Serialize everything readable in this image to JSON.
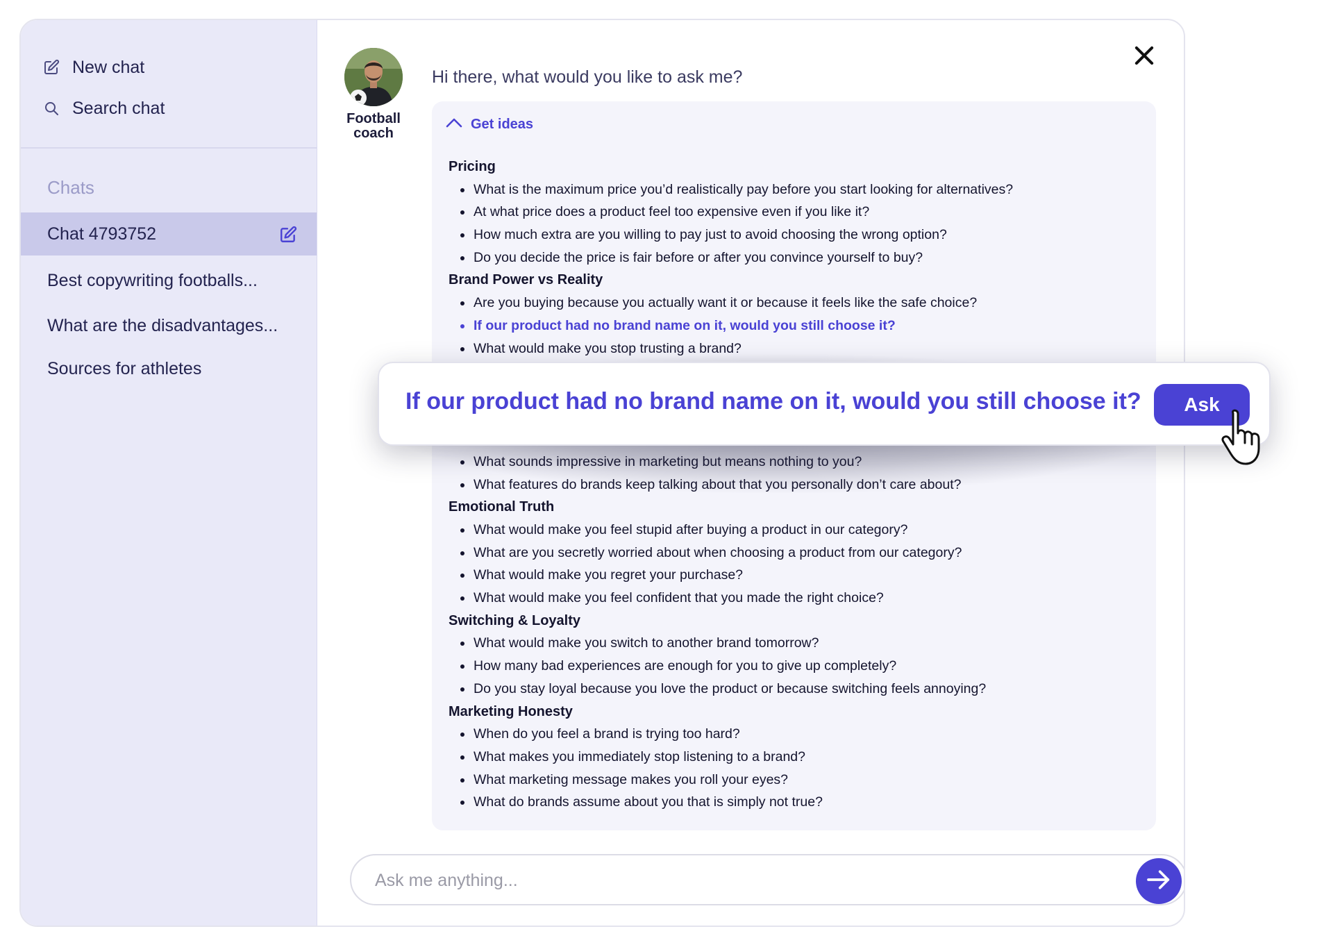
{
  "sidebar": {
    "new_chat": "New chat",
    "search_chat": "Search chat",
    "chats_heading": "Chats",
    "chats": [
      {
        "label": "Chat 4793752",
        "active": true
      },
      {
        "label": "Best copywriting footballs...",
        "active": false
      },
      {
        "label": "What are the disadvantages...",
        "active": false
      },
      {
        "label": "Sources for athletes",
        "active": false
      }
    ]
  },
  "main": {
    "agent_name": "Football coach",
    "greeting": "Hi there, what would you like to ask me?",
    "ideas_toggle": "Get ideas",
    "sections": [
      {
        "title": "Pricing",
        "questions": [
          "What is the maximum price you’d realistically pay before you start looking for alternatives?",
          "At what price does a product feel too expensive even if you like it?",
          "How much extra are you willing to pay just to avoid choosing the wrong option?",
          "Do you decide the price is fair before or after you convince yourself to buy?"
        ]
      },
      {
        "title": "Brand Power vs Reality",
        "questions": [
          "Are you buying because you actually want it or because it feels like the safe choice?",
          "If our product had no brand name on it, would you still choose it?",
          "What would make you stop trusting a brand?"
        ]
      },
      {
        "title": "",
        "questions": [
          "What sounds impressive in marketing but means nothing to you?",
          "What features do brands keep talking about that you personally don’t care about?"
        ]
      },
      {
        "title": "Emotional Truth",
        "questions": [
          "What would make you feel stupid after buying a product in our category?",
          "What are you secretly worried about when choosing a product from our category?",
          "What would make you regret your purchase?",
          "What would make you feel confident that you made the right choice?"
        ]
      },
      {
        "title": "Switching & Loyalty",
        "questions": [
          "What would make you switch to another brand tomorrow?",
          "How many bad experiences are enough for you to give up completely?",
          "Do you stay loyal because you love the product or because switching feels annoying?"
        ]
      },
      {
        "title": "Marketing Honesty",
        "questions": [
          "When do you feel a brand is trying too hard?",
          "What makes you immediately stop listening to a brand?",
          "What marketing message makes you roll your eyes?",
          "What do brands assume about you that is simply not true?"
        ]
      }
    ],
    "highlighted_question": "If our product had no brand name on it, would you still choose it?",
    "input_placeholder": "Ask me anything...",
    "input_value": ""
  },
  "callout": {
    "text": "If our product had no brand name on it, would you still choose it?",
    "ask_label": "Ask"
  },
  "colors": {
    "accent": "#4a42d4",
    "sidebar_bg": "#e9e9f8",
    "active_chat_bg": "#c9c9ea",
    "panel_bg": "#f4f4fb"
  },
  "icons": {
    "new_chat": "edit-square-icon",
    "search": "search-icon",
    "chat_edit": "edit-square-icon",
    "close": "close-icon",
    "toggle": "chevron-up-icon",
    "send": "arrow-right-icon",
    "pointer": "hand-pointer-icon"
  }
}
